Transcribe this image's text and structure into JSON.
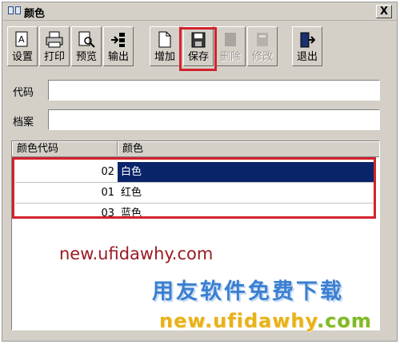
{
  "window": {
    "title": "颜色",
    "close_label": "X"
  },
  "toolbar": {
    "buttons": [
      {
        "label": "设置",
        "icon": "settings-icon",
        "enabled": true
      },
      {
        "label": "打印",
        "icon": "printer-icon",
        "enabled": true
      },
      {
        "label": "预览",
        "icon": "preview-icon",
        "enabled": true
      },
      {
        "label": "输出",
        "icon": "export-icon",
        "enabled": true
      },
      {
        "label": "增加",
        "icon": "new-doc-icon",
        "enabled": true
      },
      {
        "label": "保存",
        "icon": "save-icon",
        "enabled": true,
        "highlighted": true
      },
      {
        "label": "删除",
        "icon": "delete-icon",
        "enabled": false
      },
      {
        "label": "修改",
        "icon": "edit-icon",
        "enabled": false
      },
      {
        "label": "退出",
        "icon": "exit-icon",
        "enabled": true
      }
    ]
  },
  "form": {
    "code_label": "代码",
    "code_value": "",
    "archive_label": "档案",
    "archive_value": ""
  },
  "grid": {
    "columns": [
      "颜色代码",
      "颜色"
    ],
    "rows": [
      {
        "code": "02",
        "color": "白色",
        "selected": true
      },
      {
        "code": "01",
        "color": "红色",
        "selected": false
      },
      {
        "code": "03",
        "color": "蓝色",
        "selected": false
      }
    ]
  },
  "watermark": {
    "url_line": "new.ufidawhy.com",
    "cn_text": "用友软件免费下载",
    "url_line2_a": "new.",
    "url_line2_b": "ufidawhy",
    "url_line2_c": ".com"
  },
  "colors": {
    "accent_highlight": "#d2222c",
    "selection": "#0a246a",
    "window_bg": "#d4d0c8"
  }
}
